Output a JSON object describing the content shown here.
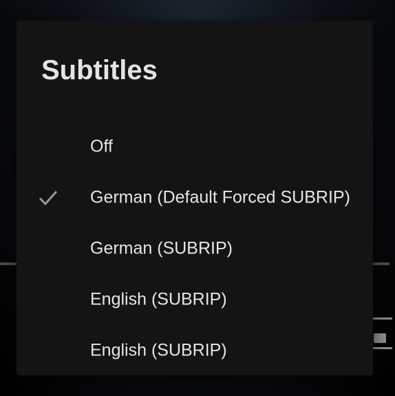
{
  "dialog": {
    "title": "Subtitles",
    "options": [
      {
        "label": "Off",
        "selected": false
      },
      {
        "label": "German (Default Forced SUBRIP)",
        "selected": true
      },
      {
        "label": "German (SUBRIP)",
        "selected": false
      },
      {
        "label": "English (SUBRIP)",
        "selected": false
      },
      {
        "label": "English (SUBRIP)",
        "selected": false
      }
    ]
  },
  "icons": {
    "selected_indicator": "checkmark-icon",
    "player_control": "picture-in-picture-icon"
  },
  "colors": {
    "dialog_background": "#141414",
    "text": "#e6e6e6",
    "check": "#9a9a9a"
  }
}
